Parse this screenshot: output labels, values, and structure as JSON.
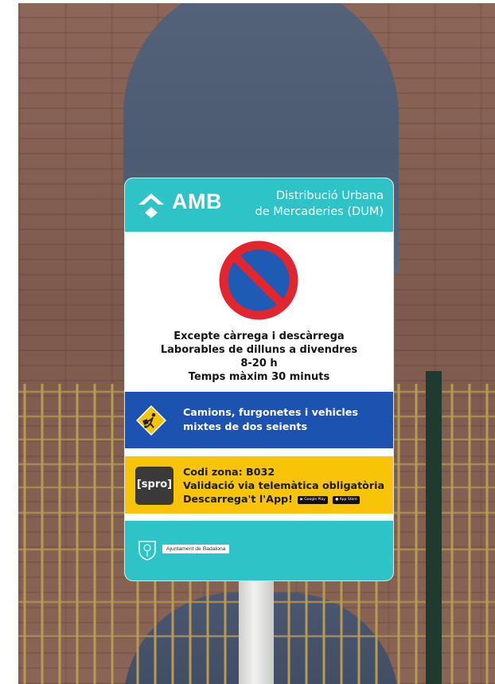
{
  "sign": {
    "brand": "AMB",
    "header_line1": "Distribució Urbana",
    "header_line2": "de Mercaderies (DUM)",
    "rules": [
      "Excepte càrrega i descàrrega",
      "Laborables de dilluns a divendres",
      "8-20 h",
      "Temps màxim 30 minuts"
    ],
    "vehicles_line1": "Camions, furgonetes i vehicles",
    "vehicles_line2": "mixtes de dos seients",
    "spro_logo": "[spro]",
    "zone_line": "Codi zona: B032",
    "validation_line": "Validació via telemàtica obligatòria",
    "app_line": "Descarrega't l'App!",
    "google_play": "Google Play",
    "app_store": "App Store",
    "municipality": "Ajuntament de Badalona"
  },
  "colors": {
    "teal": "#2ec3c6",
    "blue": "#1c53b1",
    "yellow": "#f8c407",
    "prohibition_red": "#e3262d",
    "prohibition_blue": "#1d5bb5"
  },
  "icons": [
    "amb-logo-icon",
    "no-parking-icon",
    "hand-truck-icon",
    "badalona-crest-icon"
  ]
}
